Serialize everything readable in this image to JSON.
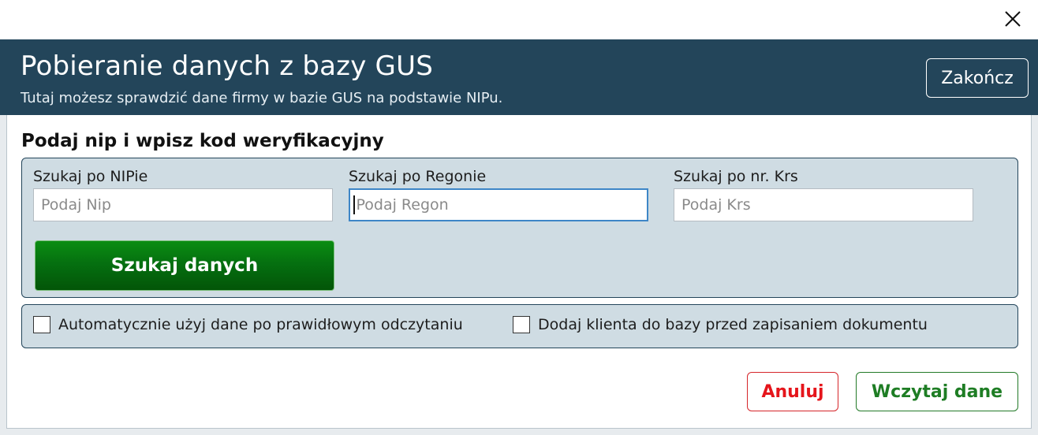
{
  "window": {
    "close_icon": "close-icon"
  },
  "header": {
    "title": "Pobieranie danych z bazy GUS",
    "subtitle": "Tutaj możesz sprawdzić dane firmy w bazie GUS na podstawie NIPu.",
    "finish_label": "Zakończ"
  },
  "main": {
    "section_title": "Podaj nip i wpisz kod weryfikacyjny",
    "fields": [
      {
        "label": "Szukaj po NIPie",
        "placeholder": "Podaj Nip",
        "value": ""
      },
      {
        "label": "Szukaj po Regonie",
        "placeholder": "Podaj Regon",
        "value": ""
      },
      {
        "label": "Szukaj po nr. Krs",
        "placeholder": "Podaj Krs",
        "value": ""
      }
    ],
    "search_button": "Szukaj danych",
    "options": [
      {
        "label": "Automatycznie użyj dane po prawidłowym odczytaniu",
        "checked": false
      },
      {
        "label": "Dodaj klienta do bazy przed zapisaniem dokumentu",
        "checked": false
      }
    ]
  },
  "footer": {
    "cancel_label": "Anuluj",
    "load_label": "Wczytaj dane"
  },
  "colors": {
    "header_bg": "#23455a",
    "panel_bg": "#cfdce3",
    "search_button_green": "#057010",
    "cancel_red": "#e5151b",
    "load_green": "#1e7d24",
    "focus_blue": "#3e86c7"
  }
}
